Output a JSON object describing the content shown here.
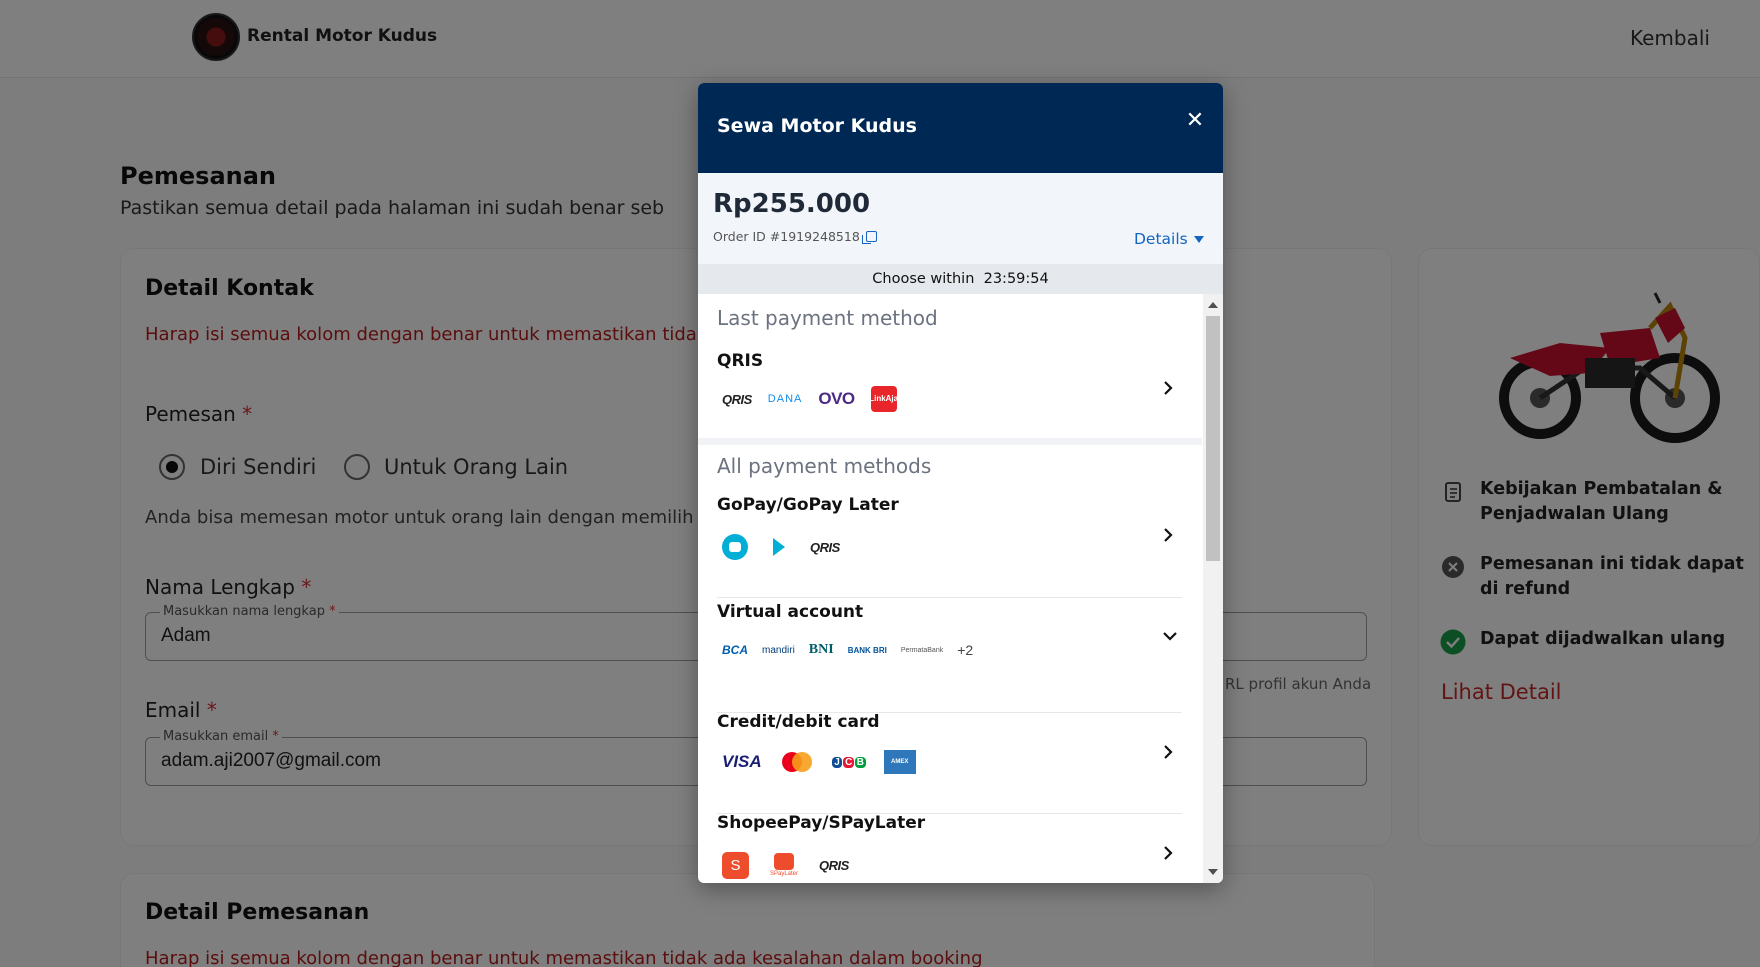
{
  "header": {
    "brand": "Rental Motor Kudus",
    "back_label": "Kembali"
  },
  "page": {
    "title": "Pemesanan",
    "subtitle": "Pastikan semua detail pada halaman ini sudah benar seb"
  },
  "contact": {
    "title": "Detail Kontak",
    "warning": "Harap isi semua kolom dengan benar untuk memastikan tidak",
    "orderer_label": "Pemesan",
    "required_mark": "*",
    "option_self": "Diri Sendiri",
    "option_other": "Untuk Orang Lain",
    "hint": "Anda bisa memesan motor untuk orang lain dengan memilih o",
    "name_label": "Nama Lengkap",
    "name_placeholder": "Masukkan nama lengkap",
    "name_value": "Adam",
    "name_help": "RL profil akun Anda",
    "email_label": "Email",
    "email_placeholder": "Masukkan email",
    "email_value": "adam.aji2007@gmail.com"
  },
  "order_section": {
    "title": "Detail Pemesanan",
    "warning": "Harap isi semua kolom dengan benar untuk memastikan tidak ada kesalahan dalam booking"
  },
  "sidebar": {
    "policy_cancel": "Kebijakan Pembatalan & Penjadwalan Ulang",
    "no_refund": "Pemesanan ini tidak dapat di refund",
    "reschedule": "Dapat dijadwalkan ulang",
    "detail_link": "Lihat Detail"
  },
  "modal": {
    "title": "Sewa Motor Kudus",
    "close_icon": "close-icon",
    "amount": "Rp255.000",
    "order_id": "Order ID #1919248518",
    "details_label": "Details",
    "timer_label": "Choose within",
    "timer_value": "23:59:54",
    "last_method_title": "Last payment method",
    "all_methods_title": "All payment methods",
    "methods": {
      "qris": {
        "label": "QRIS",
        "logos": [
          "QRIS",
          "DANA",
          "OVO",
          "LinkAja"
        ]
      },
      "gopay": {
        "label": "GoPay/GoPay Later",
        "logos": [
          "GoPay",
          "GoPay Later",
          "QRIS"
        ]
      },
      "va": {
        "label": "Virtual account",
        "logos": [
          "BCA",
          "mandiri",
          "BNI",
          "BANK BRI",
          "PermataBank"
        ],
        "more": "+2"
      },
      "card": {
        "label": "Credit/debit card",
        "logos": [
          "VISA",
          "Mastercard",
          "JCB",
          "AMEX"
        ]
      },
      "shopee": {
        "label": "ShopeePay/SPayLater",
        "logos": [
          "ShopeePay",
          "SPayLater",
          "QRIS"
        ]
      }
    }
  },
  "colors": {
    "modal_header": "#002855",
    "link_blue": "#1565c0",
    "danger_red": "#c62828",
    "success_green": "#1a9f4b"
  }
}
